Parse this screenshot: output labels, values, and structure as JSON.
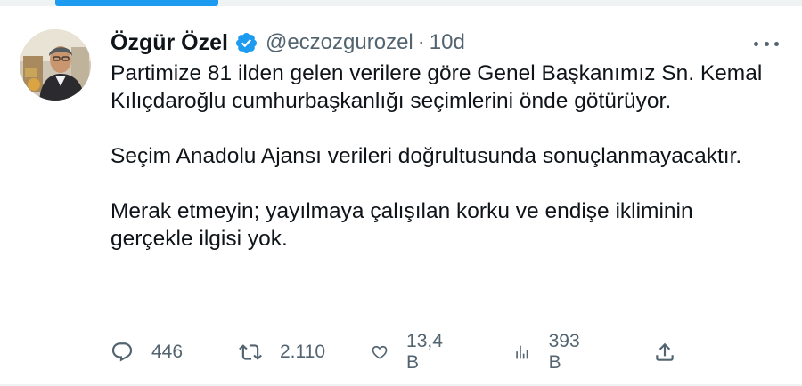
{
  "tweet": {
    "author_name": "Özgür Özel",
    "handle": "@eczozgurozel",
    "separator": "·",
    "time": "10d",
    "paragraphs": [
      "Partimize 81 ilden gelen verilere göre Genel Başkanımız Sn. Kemal Kılıçdaroğlu cumhurbaşkanlığı seçimlerini önde götürüyor.",
      "Seçim Anadolu Ajansı verileri doğrultusunda sonuçlanmayacaktır.",
      "Merak etmeyin; yayılmaya çalışılan korku ve endişe ikliminin gerçekle ilgisi yok."
    ]
  },
  "actions": {
    "replies": "446",
    "retweets": "2.110",
    "likes": "13,4 B",
    "views": "393 B"
  },
  "icons": {
    "verified": "verified-badge-icon",
    "more": "more-options-icon",
    "reply": "reply-icon",
    "retweet": "retweet-icon",
    "like": "heart-icon",
    "views": "views-icon",
    "share": "share-icon"
  },
  "colors": {
    "accent": "#1d9bf0",
    "text": "#0f1419",
    "secondary": "#536471",
    "divider": "#eff3f4"
  }
}
